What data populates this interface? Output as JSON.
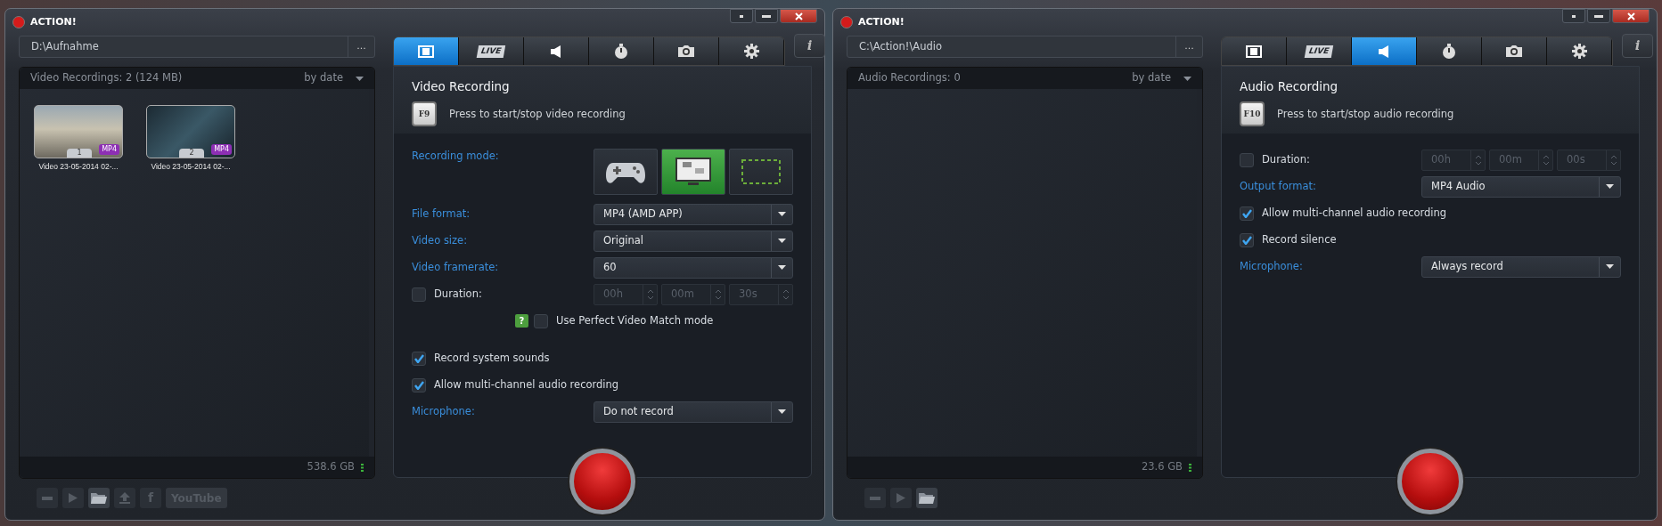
{
  "windows": [
    {
      "title": "ACTION!",
      "path": "D:\\Aufnahme",
      "browse_label": "...",
      "info_label": "i",
      "list": {
        "header": "Video Recordings: 2 (124 MB)",
        "sort": "by date",
        "free_space": "538.6 GB",
        "items": [
          {
            "number": "1",
            "badge": "MP4",
            "caption": "Video 23-05-2014 02-..."
          },
          {
            "number": "2",
            "badge": "MP4",
            "caption": "Video 23-05-2014 02-..."
          }
        ]
      },
      "tabs": [
        {
          "kind": "film",
          "selected": true
        },
        {
          "kind": "live",
          "label": "LIVE",
          "selected": false
        },
        {
          "kind": "speaker",
          "selected": false
        },
        {
          "kind": "stopwatch",
          "selected": false
        },
        {
          "kind": "camera",
          "selected": false
        },
        {
          "kind": "gear",
          "selected": false
        }
      ],
      "section": {
        "title": "Video Recording",
        "hotkey": "F9",
        "hint": "Press to start/stop video recording"
      },
      "settings": [
        {
          "kind": "mode",
          "label": "Recording mode:",
          "options": [
            {
              "kind": "gamepad",
              "selected": false
            },
            {
              "kind": "desktop",
              "selected": true
            },
            {
              "kind": "region",
              "selected": false
            }
          ]
        },
        {
          "kind": "select",
          "label": "File format:",
          "value": "MP4 (AMD APP)"
        },
        {
          "kind": "select",
          "label": "Video size:",
          "value": "Original"
        },
        {
          "kind": "select",
          "label": "Video framerate:",
          "value": "60"
        },
        {
          "kind": "duration",
          "label": "Duration:",
          "checked": false,
          "fields": [
            "00h",
            "00m",
            "30s"
          ]
        },
        {
          "kind": "help_check",
          "help": "?",
          "label": "Use Perfect Video Match mode",
          "checked": false
        },
        {
          "kind": "check",
          "label": "Record system sounds",
          "checked": true
        },
        {
          "kind": "check",
          "label": "Allow multi-channel audio recording",
          "checked": true
        },
        {
          "kind": "select",
          "label": "Microphone:",
          "value": "Do not record"
        }
      ],
      "toolbar": [
        {
          "kind": "minus"
        },
        {
          "kind": "play"
        },
        {
          "kind": "folder"
        },
        {
          "kind": "upload"
        },
        {
          "kind": "facebook",
          "label": "f"
        },
        {
          "kind": "youtube",
          "label": "YouTube"
        }
      ]
    },
    {
      "title": "ACTION!",
      "path": "C:\\Action!\\Audio",
      "browse_label": "...",
      "info_label": "i",
      "list": {
        "header": "Audio Recordings: 0",
        "sort": "by date",
        "free_space": "23.6 GB"
      },
      "tabs": [
        {
          "kind": "film",
          "selected": false
        },
        {
          "kind": "live",
          "label": "LIVE",
          "selected": false
        },
        {
          "kind": "speaker",
          "selected": true
        },
        {
          "kind": "stopwatch",
          "selected": false
        },
        {
          "kind": "camera",
          "selected": false
        },
        {
          "kind": "gear",
          "selected": false
        }
      ],
      "section": {
        "title": "Audio Recording",
        "hotkey": "F10",
        "hint": "Press to start/stop audio recording"
      },
      "settings": [
        {
          "kind": "duration",
          "label": "Duration:",
          "checked": false,
          "fields": [
            "00h",
            "00m",
            "00s"
          ]
        },
        {
          "kind": "select",
          "label": "Output format:",
          "value": "MP4 Audio"
        },
        {
          "kind": "check",
          "label": "Allow multi-channel audio recording",
          "checked": true
        },
        {
          "kind": "check",
          "label": "Record silence",
          "checked": true
        },
        {
          "kind": "select",
          "label": "Microphone:",
          "value": "Always record"
        }
      ],
      "toolbar": [
        {
          "kind": "minus"
        },
        {
          "kind": "play"
        },
        {
          "kind": "folder"
        }
      ]
    }
  ]
}
